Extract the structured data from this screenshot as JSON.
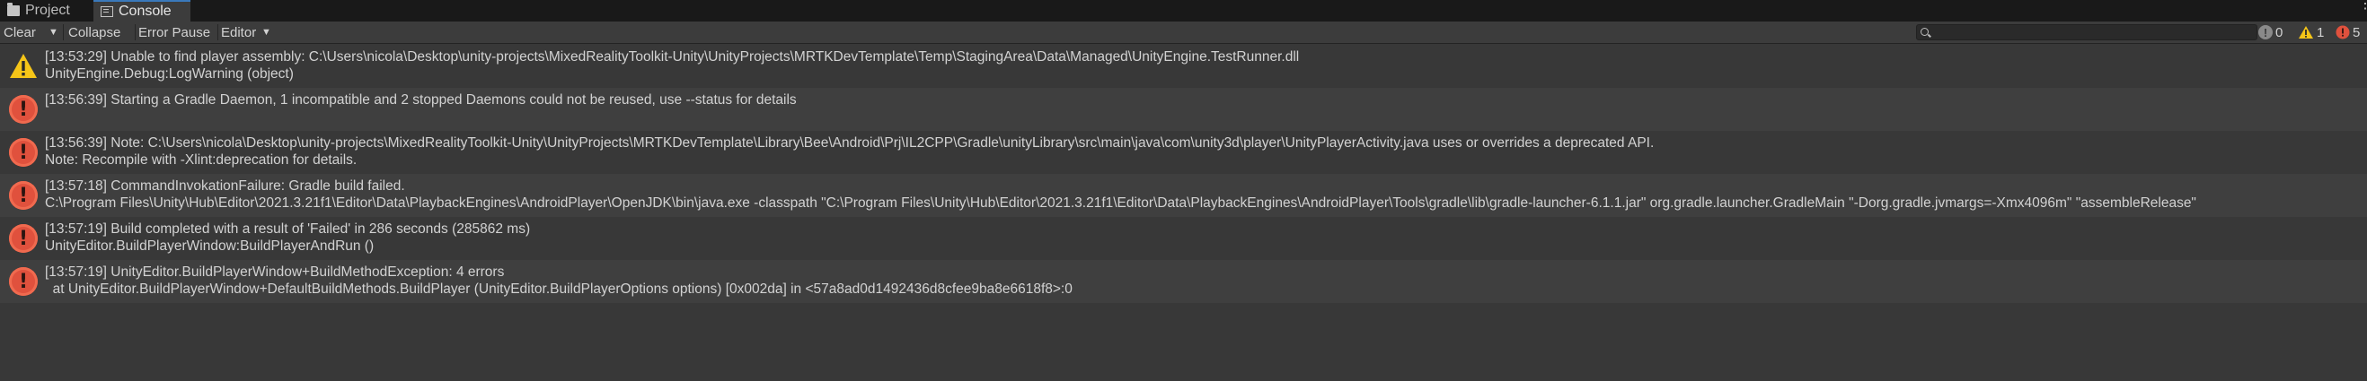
{
  "tabs": [
    {
      "label": "Project",
      "icon": "folder-icon"
    },
    {
      "label": "Console",
      "icon": "console-icon",
      "active": true
    }
  ],
  "toolbar": {
    "clear_label": "Clear",
    "collapse_label": "Collapse",
    "error_pause_label": "Error Pause",
    "editor_label": "Editor",
    "search_placeholder": "",
    "info_count": "0",
    "warning_count": "1",
    "error_count": "5"
  },
  "colors": {
    "error": "#e0513d",
    "warning": "#f5c518",
    "accent": "#3a79bb"
  },
  "logs": [
    {
      "type": "warning",
      "icon": "warning-icon",
      "line1": "[13:53:29] Unable to find player assembly: C:\\Users\\nicola\\Desktop\\unity-projects\\MixedRealityToolkit-Unity\\UnityProjects\\MRTKDevTemplate\\Temp\\StagingArea\\Data\\Managed\\UnityEngine.TestRunner.dll",
      "line2": "UnityEngine.Debug:LogWarning (object)"
    },
    {
      "type": "error",
      "icon": "error-icon",
      "line1": "[13:56:39] Starting a Gradle Daemon, 1 incompatible and 2 stopped Daemons could not be reused, use --status for details",
      "line2": ""
    },
    {
      "type": "error",
      "icon": "error-icon",
      "line1": "[13:56:39] Note: C:\\Users\\nicola\\Desktop\\unity-projects\\MixedRealityToolkit-Unity\\UnityProjects\\MRTKDevTemplate\\Library\\Bee\\Android\\Prj\\IL2CPP\\Gradle\\unityLibrary\\src\\main\\java\\com\\unity3d\\player\\UnityPlayerActivity.java uses or overrides a deprecated API.",
      "line2": "Note: Recompile with -Xlint:deprecation for details."
    },
    {
      "type": "error",
      "icon": "error-icon",
      "line1": "[13:57:18] CommandInvokationFailure: Gradle build failed.",
      "line2": "C:\\Program Files\\Unity\\Hub\\Editor\\2021.3.21f1\\Editor\\Data\\PlaybackEngines\\AndroidPlayer\\OpenJDK\\bin\\java.exe -classpath \"C:\\Program Files\\Unity\\Hub\\Editor\\2021.3.21f1\\Editor\\Data\\PlaybackEngines\\AndroidPlayer\\Tools\\gradle\\lib\\gradle-launcher-6.1.1.jar\" org.gradle.launcher.GradleMain \"-Dorg.gradle.jvmargs=-Xmx4096m\" \"assembleRelease\""
    },
    {
      "type": "error",
      "icon": "error-icon",
      "line1": "[13:57:19] Build completed with a result of 'Failed' in 286 seconds (285862 ms)",
      "line2": "UnityEditor.BuildPlayerWindow:BuildPlayerAndRun ()"
    },
    {
      "type": "error",
      "icon": "error-icon",
      "line1": "[13:57:19] UnityEditor.BuildPlayerWindow+BuildMethodException: 4 errors",
      "line2": "  at UnityEditor.BuildPlayerWindow+DefaultBuildMethods.BuildPlayer (UnityEditor.BuildPlayerOptions options) [0x002da] in <57a8ad0d1492436d8cfee9ba8e6618f8>:0"
    }
  ]
}
